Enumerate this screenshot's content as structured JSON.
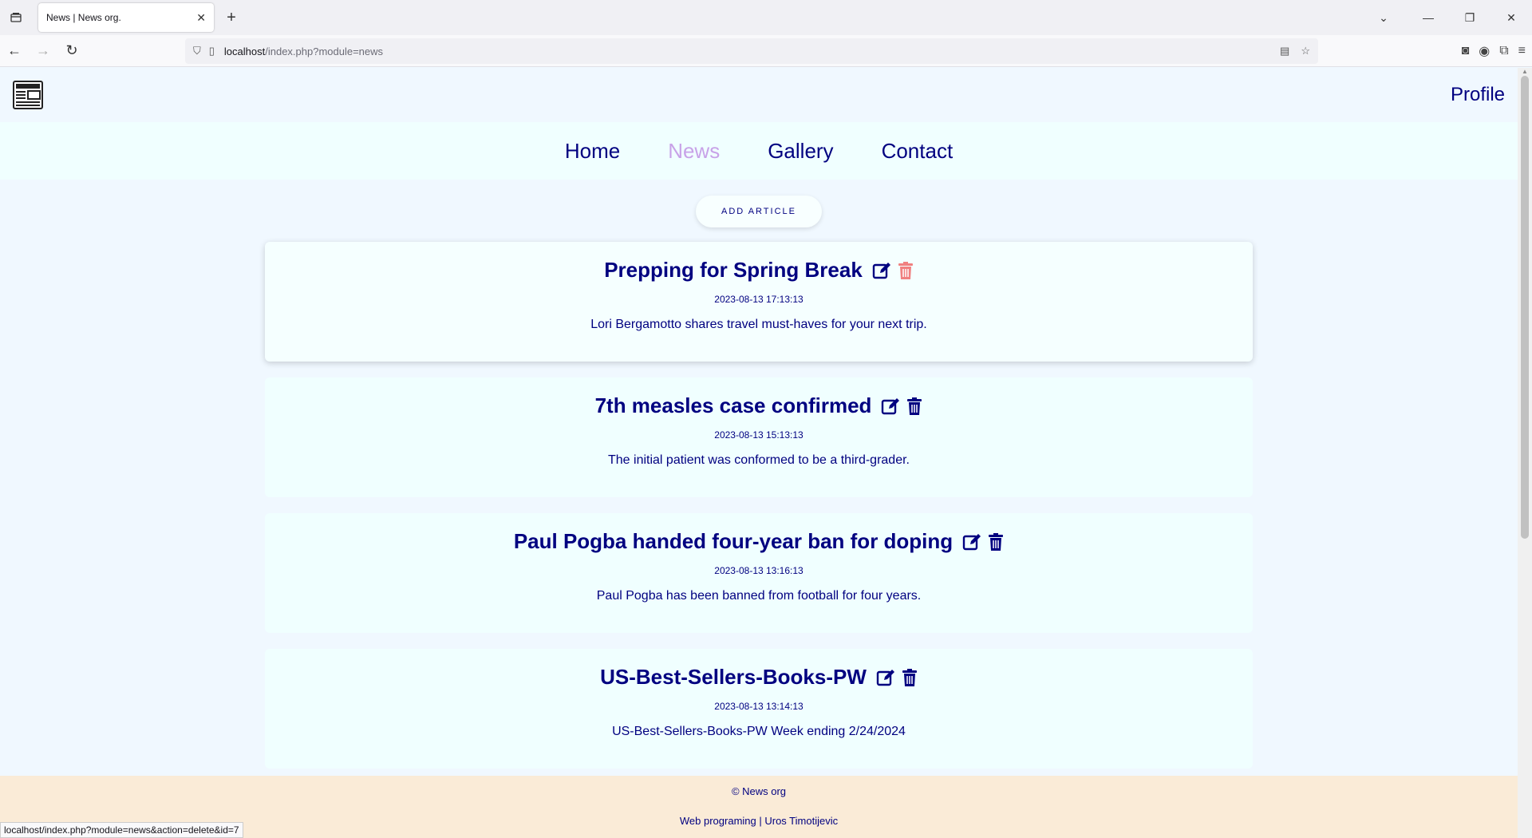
{
  "browser": {
    "tab_title": "News | News org.",
    "url_host": "localhost",
    "url_path": "/index.php?module=news",
    "status_url": "localhost/index.php?module=news&action=delete&id=7"
  },
  "header": {
    "profile_label": "Profile",
    "logo_text": "NEWS"
  },
  "nav": {
    "home": "Home",
    "news": "News",
    "gallery": "Gallery",
    "contact": "Contact"
  },
  "add_button_label": "ADD ARTICLE",
  "articles": [
    {
      "title": "Prepping for Spring Break",
      "date": "2023-08-13 17:13:13",
      "desc": "Lori Bergamotto shares travel must-haves for your next trip."
    },
    {
      "title": "7th measles case confirmed",
      "date": "2023-08-13 15:13:13",
      "desc": "The initial patient was conformed to be a third-grader."
    },
    {
      "title": "Paul Pogba handed four-year ban for doping",
      "date": "2023-08-13 13:16:13",
      "desc": "Paul Pogba has been banned from football for four years."
    },
    {
      "title": "US-Best-Sellers-Books-PW",
      "date": "2023-08-13 13:14:13",
      "desc": "US-Best-Sellers-Books-PW Week ending 2/24/2024"
    }
  ],
  "footer": {
    "copyright": "© News org",
    "credit": "Web programing | Uros Timotijevic"
  },
  "colors": {
    "primary": "#000080",
    "active_nav": "#c8a2e8",
    "delete_hover": "#f08080",
    "footer_bg": "#faebd7"
  }
}
